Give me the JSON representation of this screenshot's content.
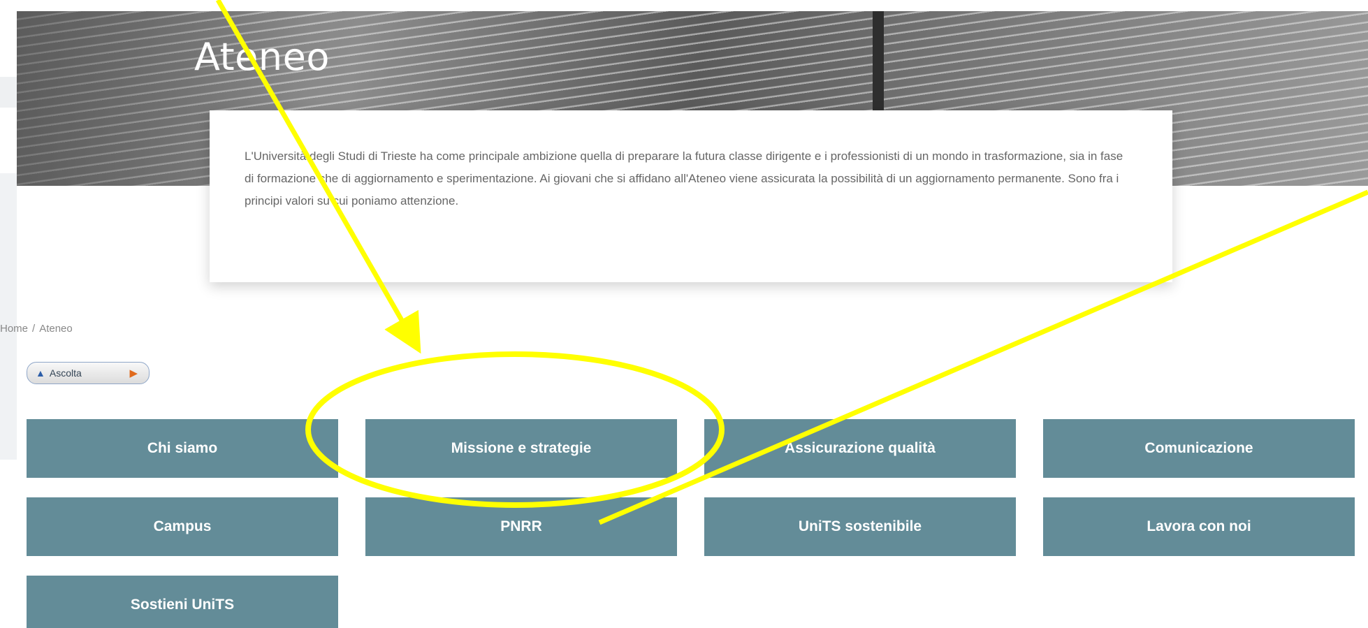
{
  "hero": {
    "title": "Ateneo"
  },
  "intro": {
    "text": "L'Università degli Studi di Trieste ha come principale ambizione quella di preparare la futura classe dirigente e i professionisti di un mondo in trasformazione, sia in fase di formazione che di aggiornamento e sperimentazione. Ai giovani che si affidano all'Ateneo viene assicurata la possibilità di un aggiornamento permanente. Sono fra i principi valori su cui poniamo attenzione."
  },
  "breadcrumb": {
    "home": "Home",
    "separator": "/",
    "current": "Ateneo"
  },
  "listen": {
    "label": "Ascolta",
    "speaker_icon": "speaker-icon",
    "play_icon": "play-icon"
  },
  "tiles": [
    {
      "label": "Chi siamo"
    },
    {
      "label": "Missione e strategie"
    },
    {
      "label": "Assicurazione qualità"
    },
    {
      "label": "Comunicazione"
    },
    {
      "label": "Campus"
    },
    {
      "label": "PNRR"
    },
    {
      "label": "UniTS sostenibile"
    },
    {
      "label": "Lavora con noi"
    },
    {
      "label": "Sostieni UniTS"
    }
  ],
  "colors": {
    "tile": "#638c98",
    "annotation": "#ffff00"
  }
}
